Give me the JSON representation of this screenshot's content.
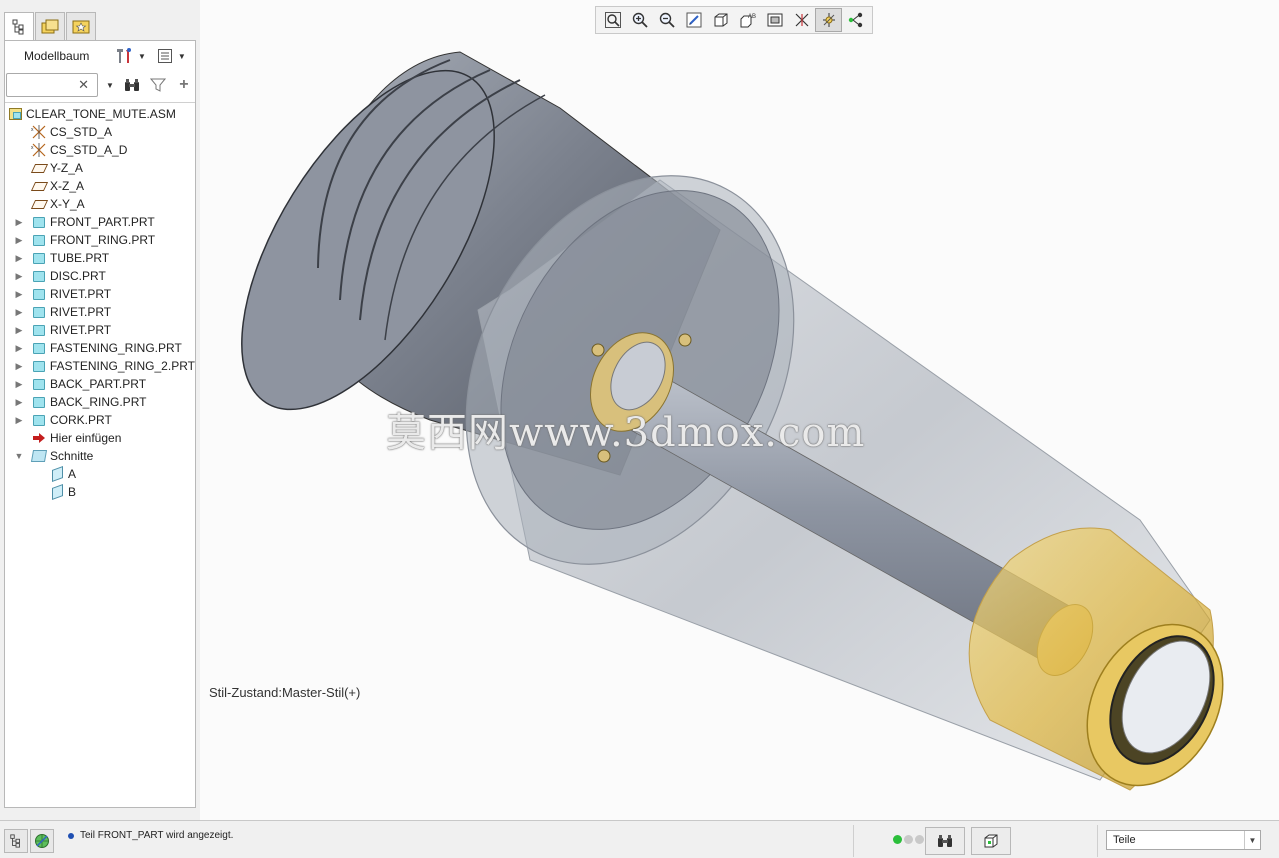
{
  "left_panel": {
    "title": "Modellbaum",
    "search": {
      "value": "",
      "placeholder": ""
    },
    "clear_glyph": "✕",
    "tree": [
      {
        "label": "CLEAR_TONE_MUTE.ASM",
        "icon": "assembly-icon",
        "level": 0,
        "expander": ""
      },
      {
        "label": "CS_STD_A",
        "icon": "coordinate-system-icon",
        "level": 1,
        "expander": ""
      },
      {
        "label": "CS_STD_A_D",
        "icon": "coordinate-system-icon",
        "level": 1,
        "expander": ""
      },
      {
        "label": "Y-Z_A",
        "icon": "datum-plane-icon",
        "level": 1,
        "expander": ""
      },
      {
        "label": "X-Z_A",
        "icon": "datum-plane-icon",
        "level": 1,
        "expander": ""
      },
      {
        "label": "X-Y_A",
        "icon": "datum-plane-icon",
        "level": 1,
        "expander": ""
      },
      {
        "label": "FRONT_PART.PRT",
        "icon": "part-icon",
        "level": 1,
        "expander": "▶"
      },
      {
        "label": "FRONT_RING.PRT",
        "icon": "part-icon",
        "level": 1,
        "expander": "▶"
      },
      {
        "label": "TUBE.PRT",
        "icon": "part-icon",
        "level": 1,
        "expander": "▶"
      },
      {
        "label": "DISC.PRT",
        "icon": "part-icon",
        "level": 1,
        "expander": "▶"
      },
      {
        "label": "RIVET.PRT",
        "icon": "part-icon",
        "level": 1,
        "expander": "▶"
      },
      {
        "label": "RIVET.PRT",
        "icon": "part-icon",
        "level": 1,
        "expander": "▶"
      },
      {
        "label": "RIVET.PRT",
        "icon": "part-icon",
        "level": 1,
        "expander": "▶"
      },
      {
        "label": "FASTENING_RING.PRT",
        "icon": "part-icon",
        "level": 1,
        "expander": "▶"
      },
      {
        "label": "FASTENING_RING_2.PRT",
        "icon": "part-icon",
        "level": 1,
        "expander": "▶"
      },
      {
        "label": "BACK_PART.PRT",
        "icon": "part-icon",
        "level": 1,
        "expander": "▶"
      },
      {
        "label": "BACK_RING.PRT",
        "icon": "part-icon",
        "level": 1,
        "expander": "▶"
      },
      {
        "label": "CORK.PRT",
        "icon": "part-icon",
        "level": 1,
        "expander": "▶"
      },
      {
        "label": "Hier einfügen",
        "icon": "insert-here-arrow-icon",
        "level": 1,
        "expander": ""
      },
      {
        "label": "Schnitte",
        "icon": "sections-folder-icon",
        "level": 1,
        "expander": "▼"
      },
      {
        "label": "A",
        "icon": "section-icon",
        "level": 2,
        "expander": ""
      },
      {
        "label": "B",
        "icon": "section-icon",
        "level": 2,
        "expander": ""
      }
    ]
  },
  "viewport": {
    "style_state": "Stil-Zustand:Master-Stil(+)",
    "watermark": "莫西网www.3dmox.com",
    "toolbar_icons": [
      "refit-icon",
      "zoom-in-icon",
      "zoom-out-icon",
      "repaint-icon",
      "display-style-icon",
      "saved-orientations-icon",
      "view-manager-icon",
      "datum-display-icon",
      "spin-center-icon",
      "annotation-display-icon"
    ]
  },
  "status_bar": {
    "message": "Teil FRONT_PART wird angezeigt.",
    "filter": {
      "value": "Teile",
      "arrow": "▼"
    }
  },
  "colors": {
    "body_gray": "#8a929f",
    "gold": "#e9c24a",
    "selection_blue": "#1f4fb2"
  }
}
